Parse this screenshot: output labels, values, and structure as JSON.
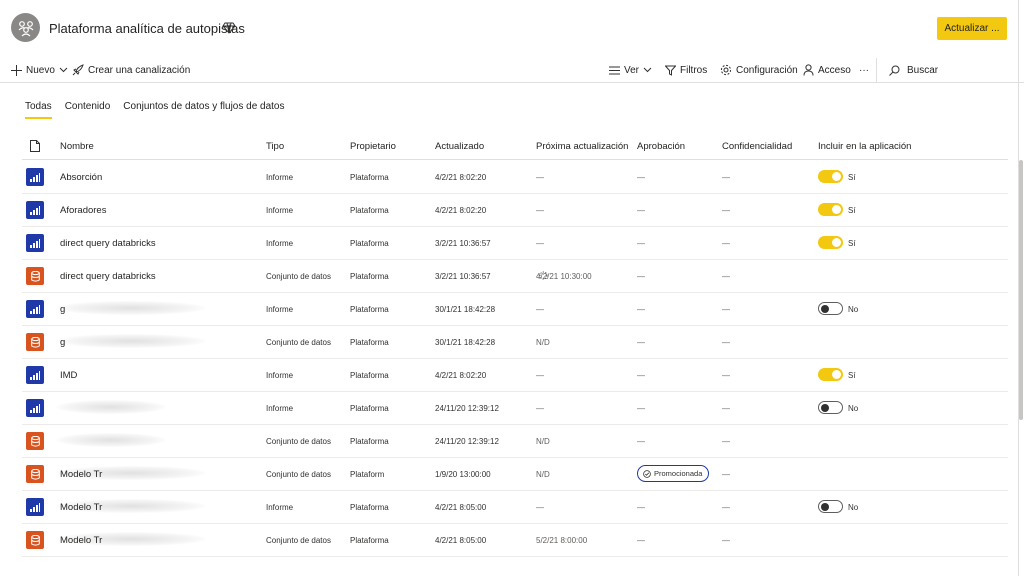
{
  "header": {
    "workspace_title": "Plataforma analítica de autopistas",
    "update_button": "Actualizar ...",
    "accent_color": "#f2c811"
  },
  "toolbar": {
    "new_label": "Nuevo",
    "pipeline_label": "Crear una canalización",
    "view_label": "Ver",
    "filters_label": "Filtros",
    "settings_label": "Configuración",
    "access_label": "Acceso",
    "more_label": "···",
    "search_label": "Buscar"
  },
  "tabs": [
    {
      "label": "Todas",
      "active": true
    },
    {
      "label": "Contenido",
      "active": false
    },
    {
      "label": "Conjuntos de datos y flujos de datos",
      "active": false
    }
  ],
  "columns": {
    "name": "Nombre",
    "type": "Tipo",
    "owner": "Propietario",
    "updated": "Actualizado",
    "next_update": "Próxima actualización",
    "approval": "Aprobación",
    "sensitivity": "Confidencialidad",
    "include": "Incluir en la aplicación"
  },
  "rows": [
    {
      "icon": "report",
      "name": "Absorción",
      "blurred": false,
      "type": "Informe",
      "owner": "Plataforma",
      "updated": "4/2/21 8:02:20",
      "next": "—",
      "approval": "—",
      "sensitivity": "—",
      "include": "on",
      "include_label": "Sí"
    },
    {
      "icon": "report",
      "name": "Aforadores",
      "blurred": false,
      "type": "Informe",
      "owner": "Plataforma",
      "updated": "4/2/21 8:02:20",
      "next": "—",
      "approval": "—",
      "sensitivity": "—",
      "include": "on",
      "include_label": "Sí"
    },
    {
      "icon": "report",
      "name": "direct query databricks",
      "blurred": false,
      "type": "Informe",
      "owner": "Plataforma",
      "updated": "3/2/21 10:36:57",
      "next": "—",
      "approval": "—",
      "sensitivity": "—",
      "include": "on",
      "include_label": "Sí"
    },
    {
      "icon": "dataset",
      "name": "direct query databricks",
      "blurred": false,
      "type": "Conjunto de datos",
      "owner": "Plataforma",
      "updated": "3/2/21 10:36:57",
      "refreshing": true,
      "next": "4/2/21 10:30:00",
      "approval": "—",
      "sensitivity": "—",
      "include": "none",
      "include_label": ""
    },
    {
      "icon": "report",
      "name": "g",
      "blurred": true,
      "type": "Informe",
      "owner": "Plataforma",
      "updated": "30/1/21 18:42:28",
      "next": "—",
      "approval": "—",
      "sensitivity": "—",
      "include": "off",
      "include_label": "No"
    },
    {
      "icon": "dataset",
      "name": "g",
      "blurred": true,
      "type": "Conjunto de datos",
      "owner": "Plataforma",
      "updated": "30/1/21 18:42:28",
      "next": "N/D",
      "approval": "—",
      "sensitivity": "—",
      "include": "none",
      "include_label": ""
    },
    {
      "icon": "report",
      "name": "IMD",
      "blurred": false,
      "type": "Informe",
      "owner": "Plataforma",
      "updated": "4/2/21 8:02:20",
      "next": "—",
      "approval": "—",
      "sensitivity": "—",
      "include": "on",
      "include_label": "Sí"
    },
    {
      "icon": "report",
      "name": "",
      "blurred": true,
      "type": "Informe",
      "owner": "Plataforma",
      "updated": "24/11/20 12:39:12",
      "next": "—",
      "approval": "—",
      "sensitivity": "—",
      "include": "off",
      "include_label": "No"
    },
    {
      "icon": "dataset",
      "name": "",
      "blurred": true,
      "type": "Conjunto de datos",
      "owner": "Plataforma",
      "updated": "24/11/20 12:39:12",
      "next": "N/D",
      "approval": "—",
      "sensitivity": "—",
      "include": "none",
      "include_label": ""
    },
    {
      "icon": "dataset",
      "name": "Modelo Tr",
      "blurred": true,
      "type": "Conjunto de datos",
      "owner": "Plataform",
      "updated": "1/9/20 13:00:00",
      "next": "N/D",
      "approval": "Promocionada",
      "sensitivity": "—",
      "include": "none",
      "include_label": ""
    },
    {
      "icon": "report",
      "name": "Modelo Tr",
      "blurred": true,
      "type": "Informe",
      "owner": "Plataforma",
      "updated": "4/2/21 8:05:00",
      "next": "—",
      "approval": "—",
      "sensitivity": "—",
      "include": "off",
      "include_label": "No"
    },
    {
      "icon": "dataset",
      "name": "Modelo Tr",
      "blurred": true,
      "type": "Conjunto de datos",
      "owner": "Plataforma",
      "updated": "4/2/21 8:05:00",
      "next": "5/2/21 8:00:00",
      "approval": "—",
      "sensitivity": "—",
      "include": "none",
      "include_label": ""
    }
  ]
}
